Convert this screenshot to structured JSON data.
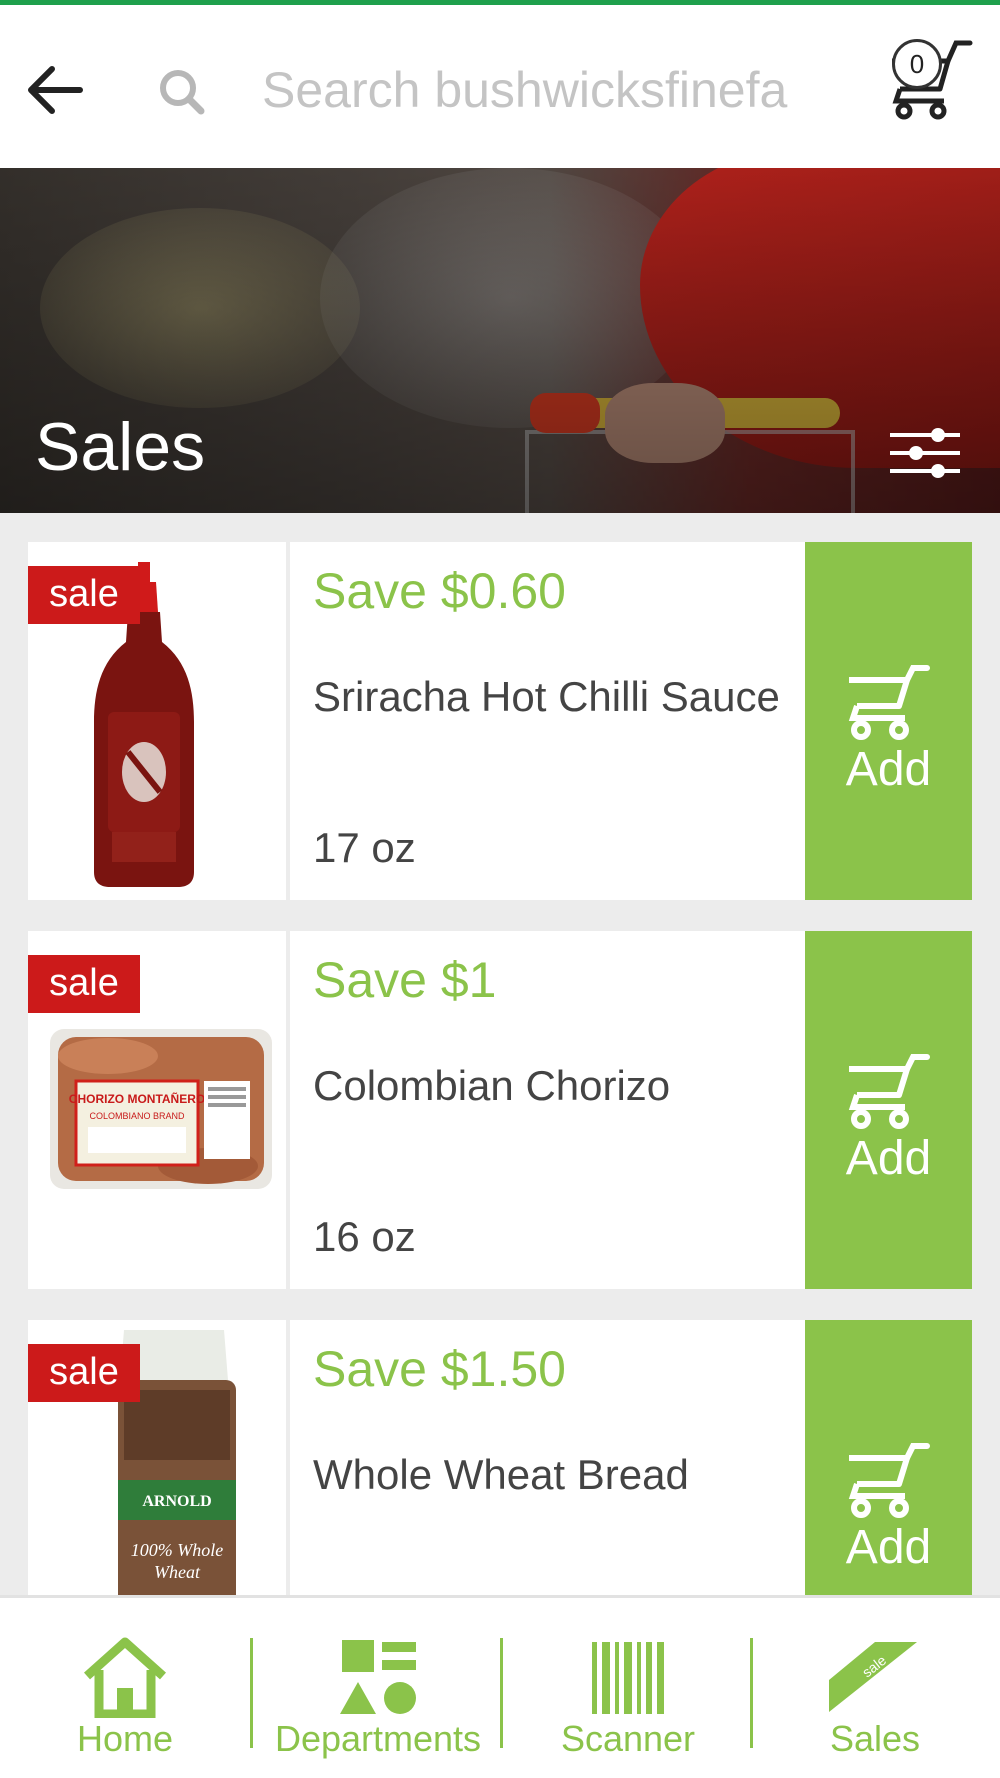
{
  "header": {
    "search_placeholder": "Search bushwicksfinefa",
    "cart_count": "0"
  },
  "hero": {
    "title": "Sales"
  },
  "products": [
    {
      "badge": "sale",
      "save": "Save $0.60",
      "name": "Sriracha Hot Chilli Sauce",
      "size": "17 oz",
      "add_label": "Add"
    },
    {
      "badge": "sale",
      "save": "Save $1",
      "name": "Colombian Chorizo",
      "size": "16 oz",
      "add_label": "Add"
    },
    {
      "badge": "sale",
      "save": "Save $1.50",
      "name": "Whole Wheat Bread",
      "size": "",
      "add_label": "Add"
    }
  ],
  "product_labels": {
    "chorizo_line1": "CHORIZO MONTAÑERO",
    "chorizo_line2": "COLOMBIANO BRAND",
    "bread_brand": "ARNOLD",
    "bread_type_1": "100% Whole",
    "bread_type_2": "Wheat"
  },
  "bottom_nav": {
    "items": [
      {
        "label": "Home",
        "icon": "home-icon"
      },
      {
        "label": "Departments",
        "icon": "departments-icon"
      },
      {
        "label": "Scanner",
        "icon": "barcode-icon"
      },
      {
        "label": "Sales",
        "icon": "sale-tag-icon",
        "icon_text": "sale"
      }
    ]
  },
  "colors": {
    "accent_green": "#8bc34a",
    "top_bar_green": "#1fa04c",
    "sale_red": "#cc1a1a",
    "text_dark": "#444444"
  }
}
